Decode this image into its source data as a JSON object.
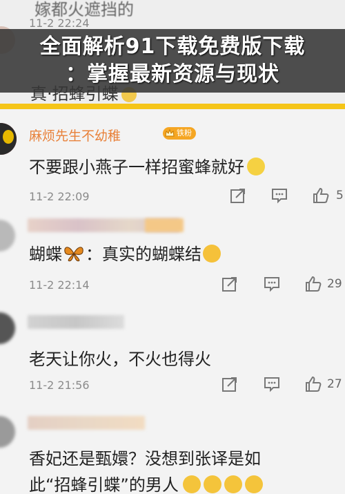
{
  "banner": {
    "line1": "全面解析91下载免费版下载",
    "line2": "：掌握最新资源与现状"
  },
  "top_ghost": {
    "comment_fragment": "嫁都火遮挡的",
    "time": "11-2 22:24",
    "reply": "真·招蜂引蝶"
  },
  "comments": [
    {
      "user": "麻烦先生不幼稚",
      "badge": "铁粉",
      "text": "不要跟小燕子一样招蜜蜂就好",
      "time": "11-2 22:09",
      "likes": "5"
    },
    {
      "user": "",
      "text": "蝴蝶",
      "text_after": "：真实的蝴蝶结",
      "time": "11-2 22:14",
      "likes": "29"
    },
    {
      "user": "",
      "text": "老天让你火，不火也得火",
      "time": "11-2 21:56",
      "likes": "27"
    },
    {
      "user": "",
      "text": "香妃还是甄嬛？没想到张译是如",
      "text_line2": "此“招蜂引蝶”的男人"
    }
  ],
  "icons": {
    "share": "share-icon",
    "reply": "comment-icon",
    "like": "thumbs-up-icon"
  },
  "colors": {
    "username": "#e8813a",
    "banner_bg": "#373737",
    "accent_bar": "#f5c518"
  }
}
